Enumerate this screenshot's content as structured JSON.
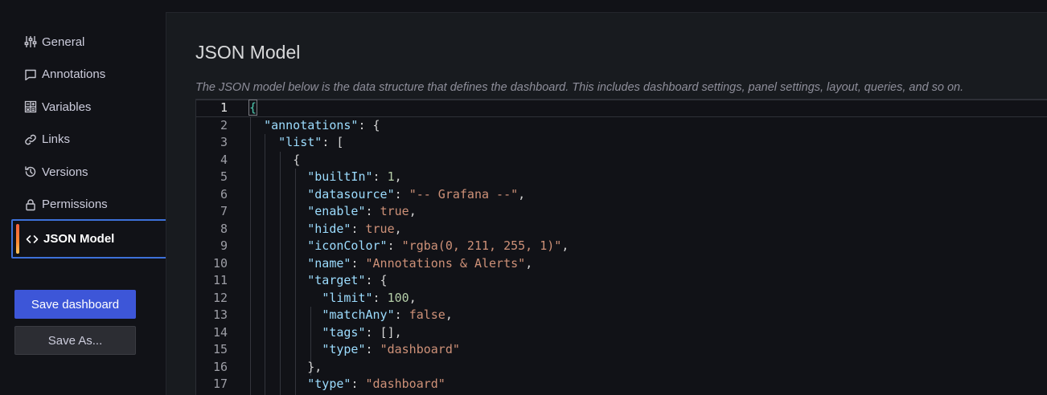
{
  "sidebar": {
    "items": [
      {
        "label": "General",
        "icon": "sliders-icon"
      },
      {
        "label": "Annotations",
        "icon": "comment-icon"
      },
      {
        "label": "Variables",
        "icon": "calculator-icon"
      },
      {
        "label": "Links",
        "icon": "link-icon"
      },
      {
        "label": "Versions",
        "icon": "history-icon"
      },
      {
        "label": "Permissions",
        "icon": "lock-icon"
      },
      {
        "label": "JSON Model",
        "icon": "code-icon",
        "active": true
      }
    ],
    "save_label": "Save dashboard",
    "save_as_label": "Save As..."
  },
  "main": {
    "title": "JSON Model",
    "description": "The JSON model below is the data structure that defines the dashboard. This includes dashboard settings, panel settings, layout, queries, and so on."
  },
  "editor": {
    "current_line": 1,
    "line_numbers": [
      "1",
      "2",
      "3",
      "4",
      "5",
      "6",
      "7",
      "8",
      "9",
      "10",
      "11",
      "12",
      "13",
      "14",
      "15",
      "16",
      "17"
    ],
    "lines": {
      "l1": "{",
      "l2_key": "\"annotations\"",
      "l2_rest": ": {",
      "l3_key": "\"list\"",
      "l3_rest": ": [",
      "l4": "{",
      "l5_key": "\"builtIn\"",
      "l5_val": "1",
      "l6_key": "\"datasource\"",
      "l6_val": "\"-- Grafana --\"",
      "l7_key": "\"enable\"",
      "l7_val": "true",
      "l8_key": "\"hide\"",
      "l8_val": "true",
      "l9_key": "\"iconColor\"",
      "l9_val": "\"rgba(0, 211, 255, 1)\"",
      "l10_key": "\"name\"",
      "l10_val": "\"Annotations & Alerts\"",
      "l11_key": "\"target\"",
      "l11_rest": ": {",
      "l12_key": "\"limit\"",
      "l12_val": "100",
      "l13_key": "\"matchAny\"",
      "l13_val": "false",
      "l14_key": "\"tags\"",
      "l14_rest": ": [],",
      "l15_key": "\"type\"",
      "l15_val": "\"dashboard\"",
      "l16": "},",
      "l17_key": "\"type\"",
      "l17_val": "\"dashboard\""
    }
  },
  "colors": {
    "accent": "#3d56d8",
    "active_border": "#3d71d9",
    "key": "#9cdcfe",
    "string": "#ce9178",
    "number": "#b5cea8"
  }
}
